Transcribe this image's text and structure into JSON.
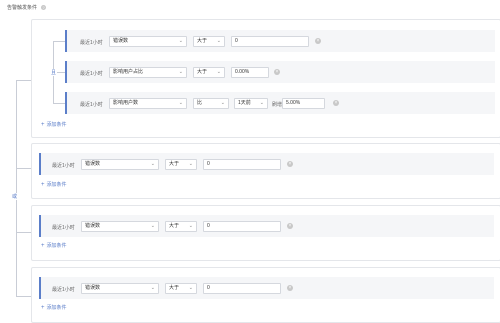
{
  "header": {
    "title": "告警触发条件",
    "help_icon": "?"
  },
  "logic": {
    "or_label": "或",
    "and_label": "且"
  },
  "window_label": "最近1小时",
  "add_condition": "添加条件",
  "delete_icon": "×",
  "group1": {
    "rows": [
      {
        "metric": "错误数",
        "operator": "大于",
        "value": "0"
      },
      {
        "metric": "影响用户占比",
        "operator": "大于",
        "value": "0.00%"
      },
      {
        "metric": "影响用户数",
        "operator": "比",
        "compare": "1天前",
        "change_label": "刷增多",
        "value": "5.00%"
      }
    ]
  },
  "group2": {
    "metric": "错误数",
    "operator": "大于",
    "value": "0"
  },
  "group3": {
    "metric": "错误数",
    "operator": "大于",
    "value": "0"
  },
  "group4": {
    "metric": "错误数",
    "operator": "大于",
    "value": "0"
  }
}
